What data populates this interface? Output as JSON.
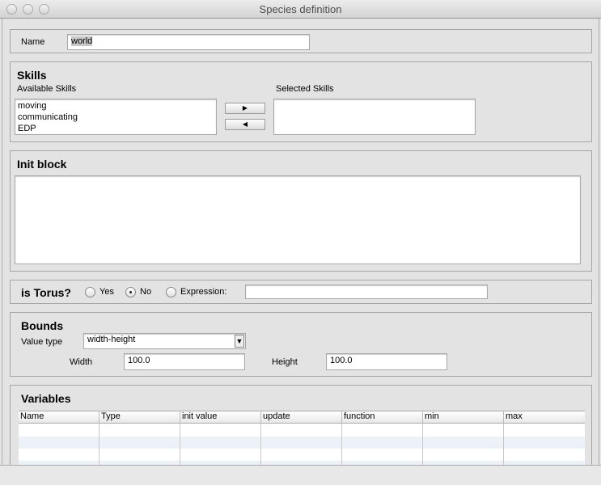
{
  "window": {
    "title": "Species definition"
  },
  "name": {
    "label": "Name",
    "value": "world"
  },
  "skills": {
    "title": "Skills",
    "available_label": "Available Skills",
    "selected_label": "Selected Skills",
    "available": [
      "moving",
      "communicating",
      "EDP"
    ],
    "selected": [],
    "add_icon": "triangle-right",
    "remove_icon": "triangle-left"
  },
  "init_block": {
    "title": "Init block",
    "value": ""
  },
  "torus": {
    "title": "is Torus?",
    "options": [
      "Yes",
      "No",
      "Expression:"
    ],
    "selected": "No",
    "expression": ""
  },
  "bounds": {
    "title": "Bounds",
    "value_type_label": "Value type",
    "value_type": "width-height",
    "width_label": "Width",
    "width": "100.0",
    "height_label": "Height",
    "height": "100.0"
  },
  "variables": {
    "title": "Variables",
    "columns": [
      "Name",
      "Type",
      "init value",
      "update",
      "function",
      "min",
      "max"
    ],
    "rows": []
  }
}
